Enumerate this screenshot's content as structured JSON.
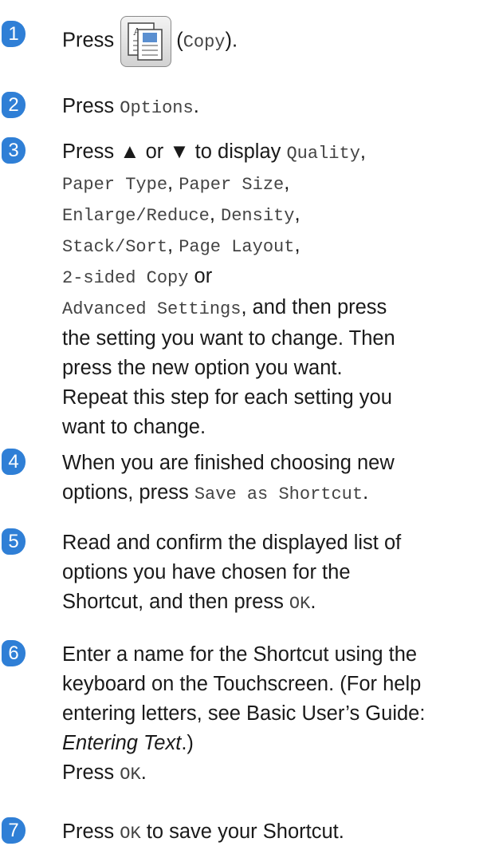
{
  "steps": [
    {
      "num": "1",
      "t1": "Press",
      "icon": "copy-icon",
      "t2": "(",
      "mono1": "Copy",
      "t3": ")."
    },
    {
      "num": "2",
      "t1": "Press ",
      "mono1": "Options",
      "t2": "."
    },
    {
      "num": "3",
      "t1": "Press ▲ or ▼ to display ",
      "m_quality": "Quality",
      "m_paper_type": "Paper Type",
      "m_paper_size": "Paper Size",
      "m_enlarge": "Enlarge/Reduce",
      "m_density": "Density",
      "m_stack": "Stack/Sort",
      "m_layout": "Page Layout",
      "m_2sided": "2-sided Copy",
      "or": " or",
      "m_advanced": "Advanced Settings",
      "t_then": ", and then press",
      "l1": "the setting you want to change. Then",
      "l2": "press the new option you want.",
      "l3": "Repeat this step for each setting you",
      "l4": "want to change."
    },
    {
      "num": "4",
      "l1": "When you are finished choosing new",
      "t1": "options, press ",
      "mono1": "Save as Shortcut",
      "t2": "."
    },
    {
      "num": "5",
      "l1": "Read and confirm the displayed list of",
      "l2": "options you have chosen for the",
      "t1": "Shortcut, and then press ",
      "mono1": "OK",
      "t2": "."
    },
    {
      "num": "6",
      "l1": "Enter a name for the Shortcut using the",
      "l2": "keyboard on the Touchscreen. (For help",
      "l3": "entering letters, see Basic User’s Guide:",
      "it1": "Entering Text",
      "t1": ".)",
      "t2": "Press ",
      "mono1": "OK",
      "t3": "."
    },
    {
      "num": "7",
      "t1": "Press ",
      "mono1": "OK",
      "t2": " to save your Shortcut."
    }
  ]
}
